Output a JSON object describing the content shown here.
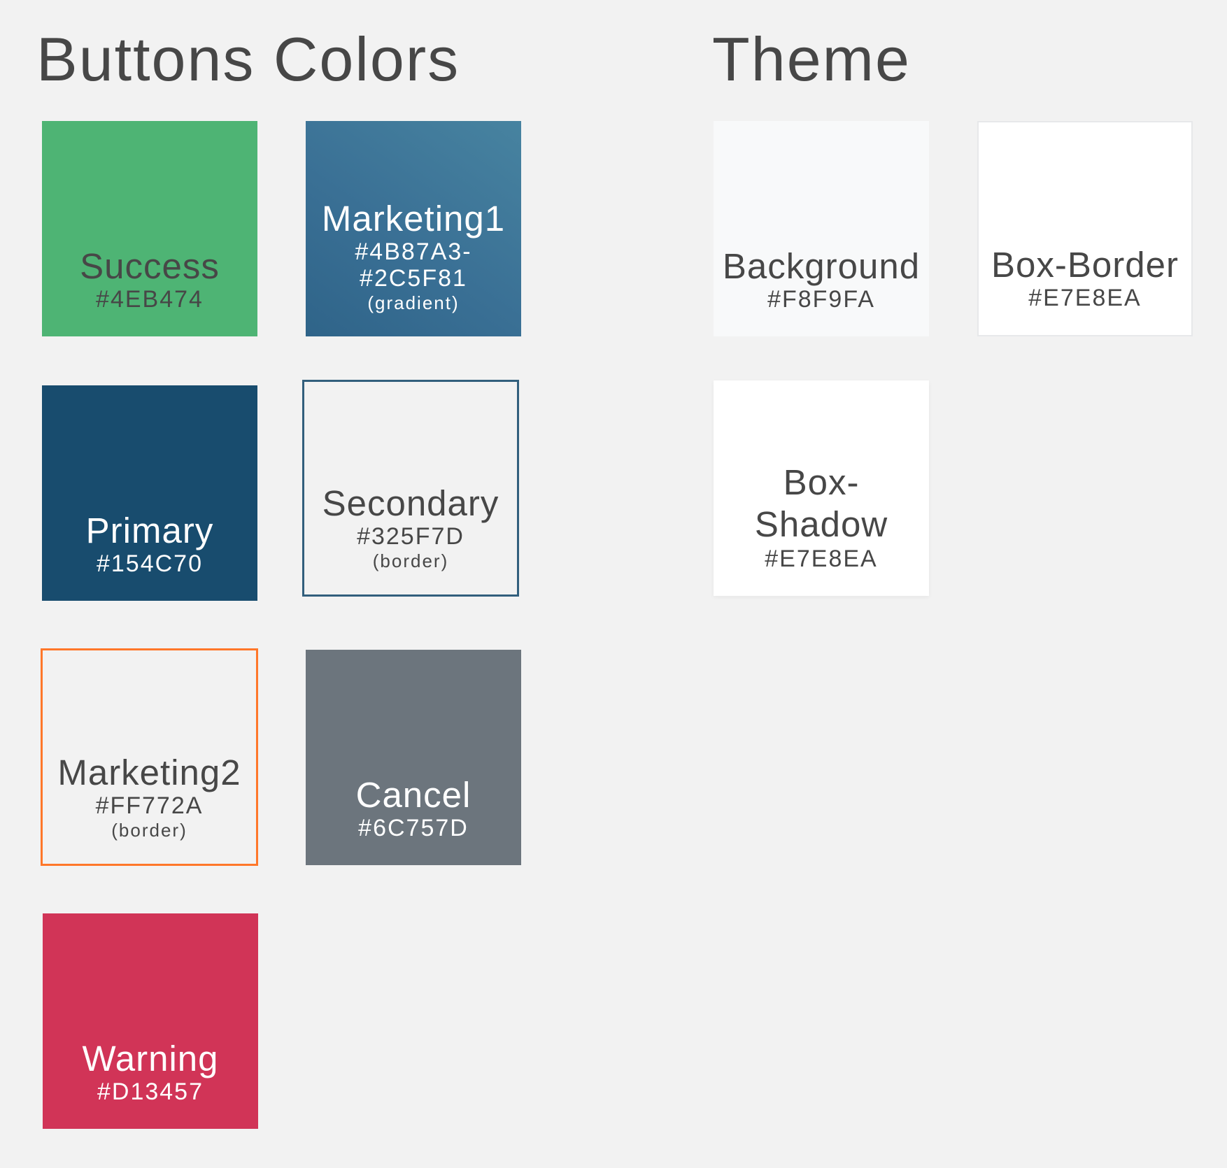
{
  "headings": {
    "buttons": "Buttons Colors",
    "theme": "Theme"
  },
  "buttons": {
    "success": {
      "name": "Success",
      "hex": "#4EB474"
    },
    "marketing1": {
      "name": "Marketing1",
      "hex": "#4B87A3-\n#2C5F81",
      "note": "(gradient)"
    },
    "primary": {
      "name": "Primary",
      "hex": "#154C70"
    },
    "secondary": {
      "name": "Secondary",
      "hex": "#325F7D",
      "note": "(border)"
    },
    "marketing2": {
      "name": "Marketing2",
      "hex": "#FF772A",
      "note": "(border)"
    },
    "cancel": {
      "name": "Cancel",
      "hex": "#6C757D"
    },
    "warning": {
      "name": "Warning",
      "hex": "#D13457"
    }
  },
  "theme": {
    "background": {
      "name": "Background",
      "hex": "#F8F9FA"
    },
    "box_border": {
      "name": "Box-Border",
      "hex": "#E7E8EA"
    },
    "box_shadow": {
      "name": "Box-\nShadow",
      "hex": "#E7E8EA"
    }
  }
}
